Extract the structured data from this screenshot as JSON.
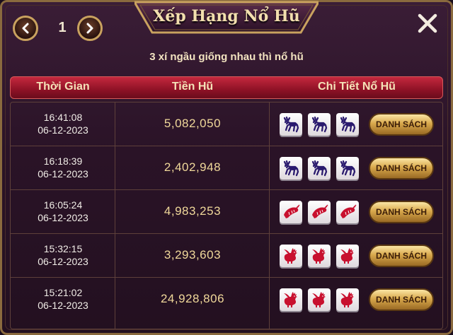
{
  "title": "Xếp Hạng Nổ Hũ",
  "pager": {
    "page": "1"
  },
  "subtitle": "3 xí ngầu giống nhau thì nổ hũ",
  "columns": {
    "time": "Thời Gian",
    "amount": "Tiền Hũ",
    "detail": "Chi Tiết Nổ Hũ"
  },
  "button_label": "DANH SÁCH",
  "rows": [
    {
      "time": "16:41:08",
      "date": "06-12-2023",
      "amount": "5,082,050",
      "dice": [
        "deer-icon",
        "deer-icon",
        "deer-icon"
      ]
    },
    {
      "time": "16:18:39",
      "date": "06-12-2023",
      "amount": "2,402,948",
      "dice": [
        "deer-icon",
        "deer-icon",
        "deer-icon"
      ]
    },
    {
      "time": "16:05:24",
      "date": "06-12-2023",
      "amount": "4,983,253",
      "dice": [
        "shrimp-icon",
        "shrimp-icon",
        "shrimp-icon"
      ]
    },
    {
      "time": "15:32:15",
      "date": "06-12-2023",
      "amount": "3,293,603",
      "dice": [
        "rooster-icon",
        "rooster-icon",
        "rooster-icon"
      ]
    },
    {
      "time": "15:21:02",
      "date": "06-12-2023",
      "amount": "24,928,806",
      "dice": [
        "rooster-icon",
        "rooster-icon",
        "rooster-icon"
      ]
    }
  ],
  "colors": {
    "deer": "#2a1a6e",
    "shrimp": "#c8102e",
    "rooster": "#c8102e",
    "header": "#a3172f",
    "gold": "#d9a94c"
  }
}
